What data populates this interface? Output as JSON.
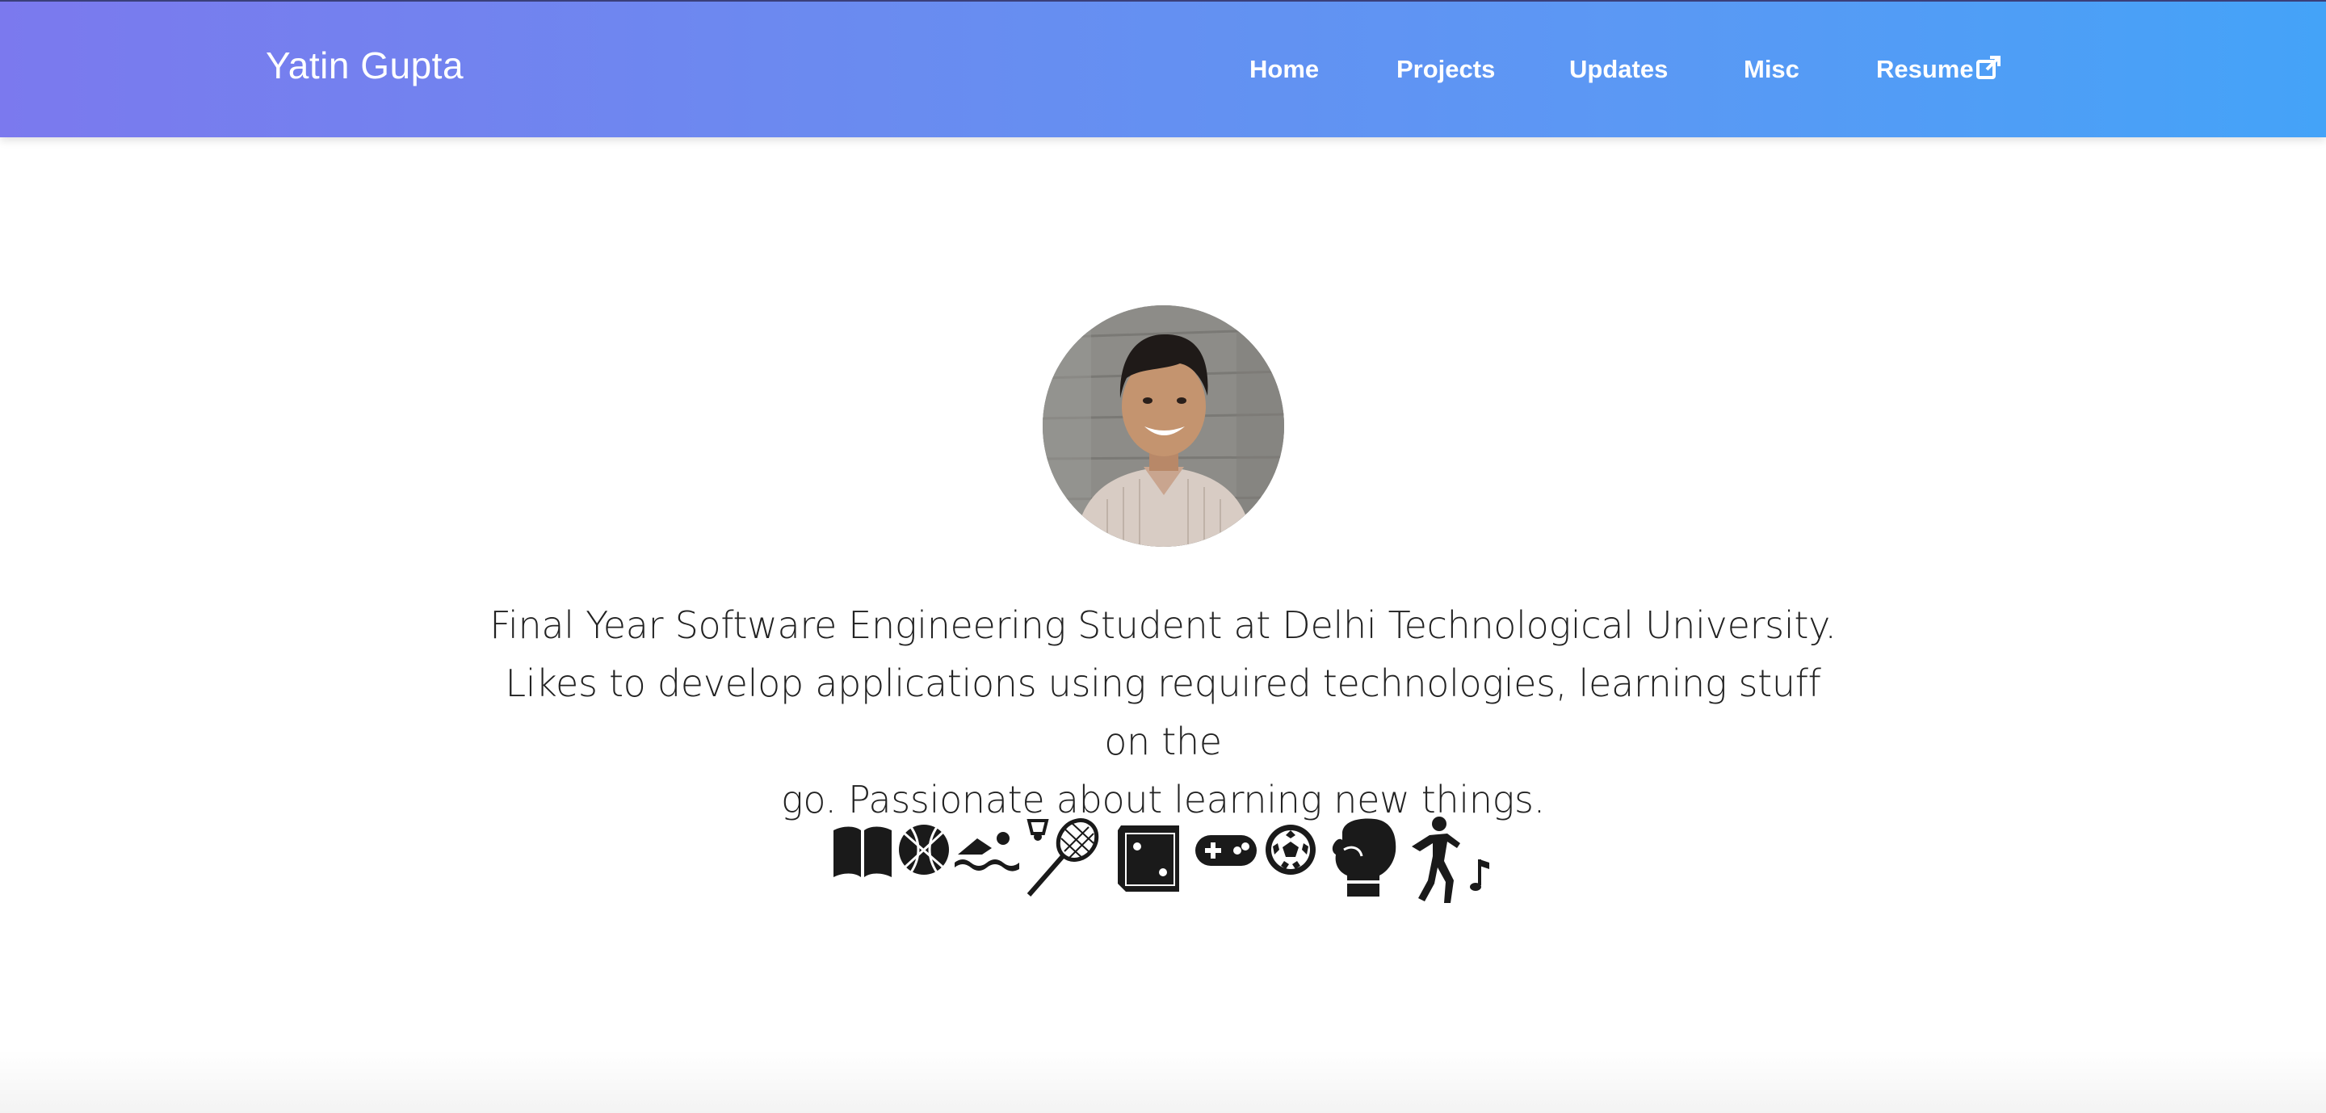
{
  "brand": {
    "name": "Yatin Gupta"
  },
  "nav": {
    "home": "Home",
    "projects": "Projects",
    "updates": "Updates",
    "misc": "Misc",
    "resume": "Resume"
  },
  "hero": {
    "intro_lines": [
      "Final Year Software Engineering Student at Delhi Technological University.",
      "Likes to develop applications using required technologies, learning stuff on the",
      "go. Passionate about learning new things."
    ]
  },
  "hobbies": [
    "book-icon",
    "basketball-icon",
    "swimming-icon",
    "badminton-icon",
    "dice-icon",
    "gamepad-icon",
    "soccer-ball-icon",
    "boxing-glove-icon",
    "dancing-icon"
  ],
  "colors": {
    "nav_gradient_start": "#7b79ee",
    "nav_gradient_end": "#44a3f8",
    "text": "#222222"
  }
}
